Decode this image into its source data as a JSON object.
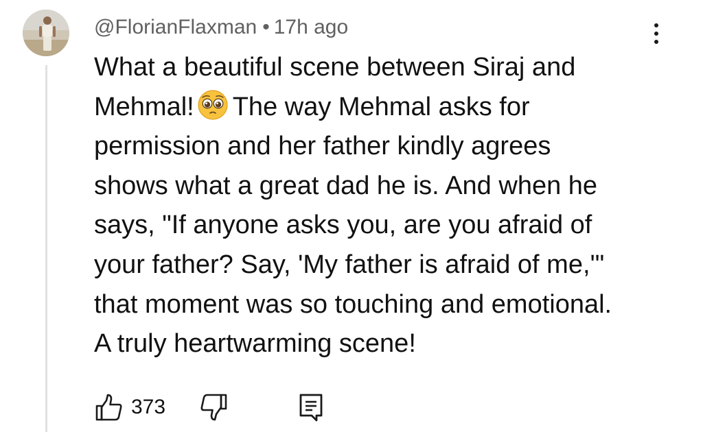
{
  "comment": {
    "author": "@FlorianFlaxman",
    "separator": "•",
    "timestamp": "17h ago",
    "lines": {
      "l1": "What a beautiful scene between Siraj and",
      "l2_before_emoji": "Mehmal!",
      "l2_after_emoji": "The way Mehmal asks for",
      "l3": "permission and her father kindly agrees",
      "l4": "shows what a great dad he is. And when he",
      "l5": "says, \"If anyone asks you, are you afraid of",
      "l6": "your father? Say, 'My father is afraid of me,'\"",
      "l7": "that moment was so touching and emotional.",
      "l8": "A truly heartwarming scene!"
    },
    "emoji": "pleading-face"
  },
  "actions": {
    "like_count": "373",
    "like_icon": "thumbs-up-icon",
    "dislike_icon": "thumbs-down-icon",
    "reply_icon": "reply-comment-icon",
    "more_icon": "more-vertical-icon"
  },
  "colors": {
    "text": "#111111",
    "meta": "#606060",
    "thread_line": "#e1e1e1",
    "icon": "#1a1a1a"
  }
}
